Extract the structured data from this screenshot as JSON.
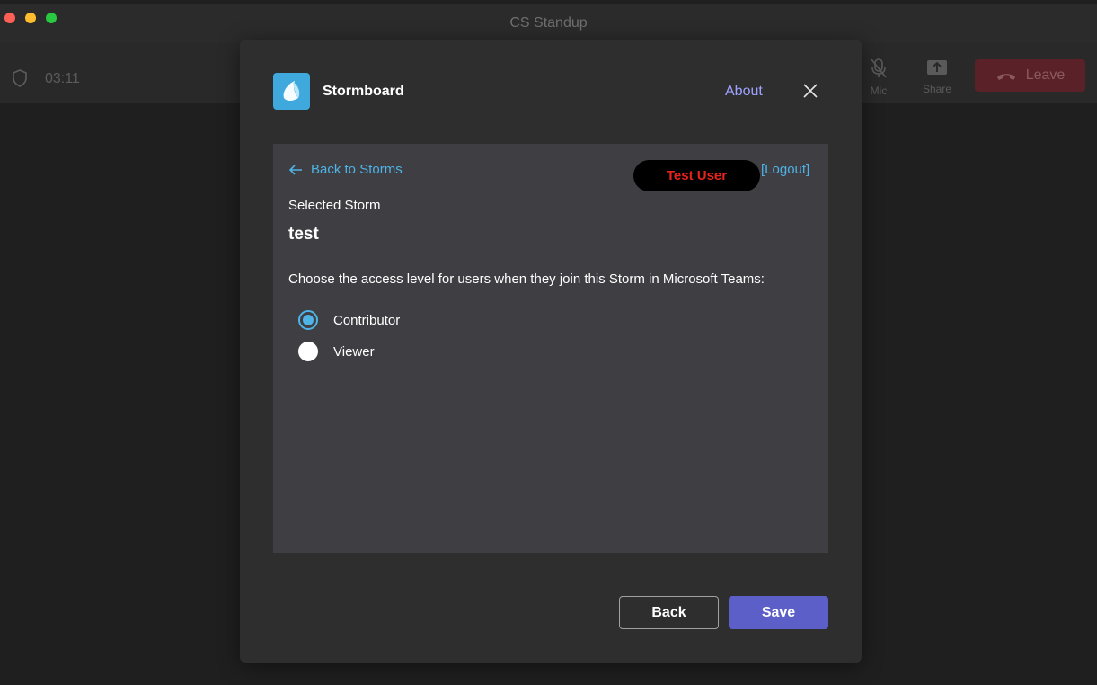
{
  "window": {
    "title": "CS Standup"
  },
  "meeting": {
    "timer": "03:11",
    "controls": [
      {
        "label": "Mic",
        "icon": "mic-off-icon"
      },
      {
        "label": "Share",
        "icon": "share-icon"
      }
    ],
    "leave_label": "Leave"
  },
  "dialog": {
    "app_name": "Stormboard",
    "about_label": "About",
    "back_to_storms": "Back to Storms",
    "user_name": "Test User",
    "logout_label": "[Logout]",
    "selected_label": "Selected Storm",
    "storm_name": "test",
    "instructions": "Choose the access level for users when they join this Storm in Microsoft Teams:",
    "options": [
      {
        "label": "Contributor",
        "checked": true
      },
      {
        "label": "Viewer",
        "checked": false
      }
    ],
    "back_button": "Back",
    "save_button": "Save"
  },
  "colors": {
    "accent_link": "#4fb3e6",
    "about_link": "#9ea2ff",
    "primary_button": "#5b5fc7",
    "user_name": "#e8231d",
    "leave_button": "#5a2228"
  }
}
